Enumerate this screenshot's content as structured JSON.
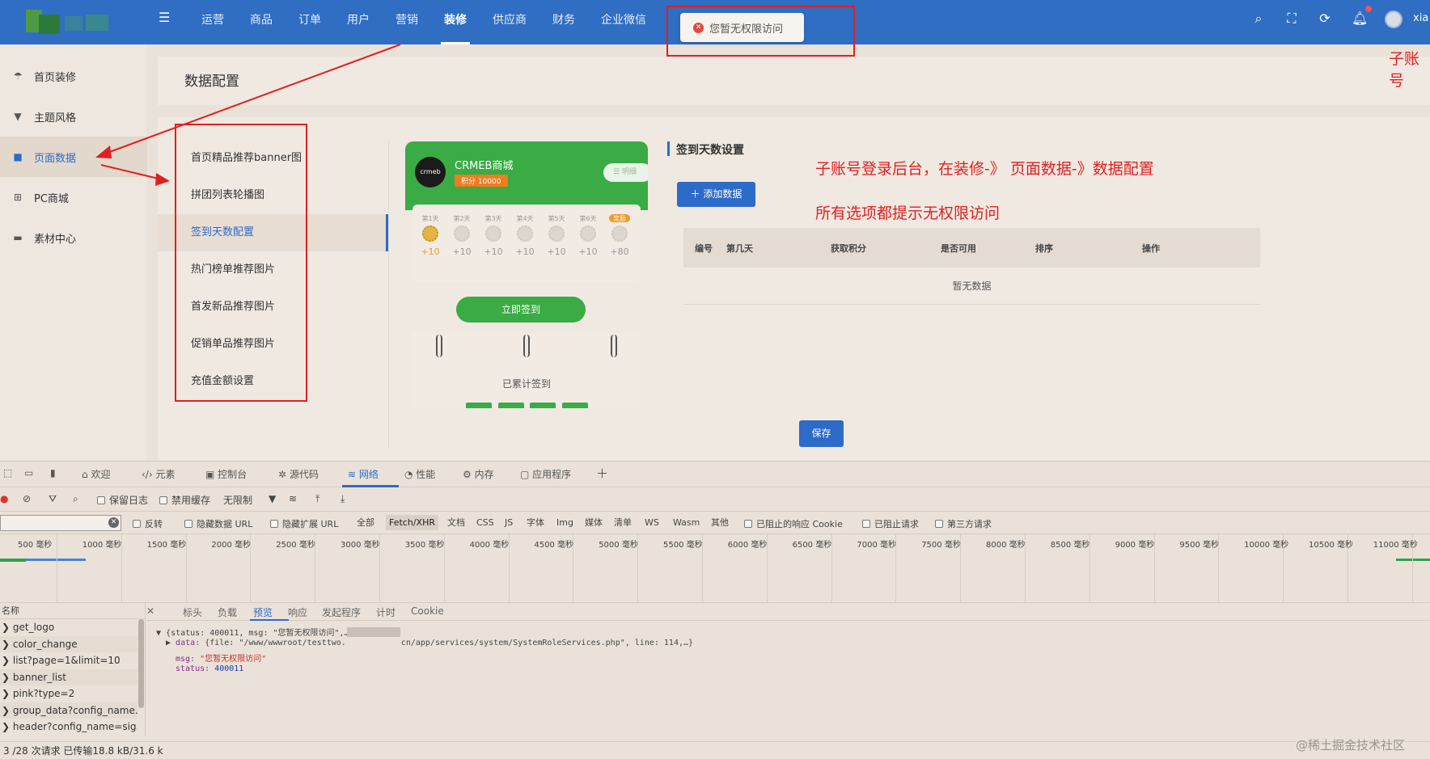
{
  "header": {
    "nav": [
      "运营",
      "商品",
      "订单",
      "用户",
      "营销",
      "装修",
      "供应商",
      "财务",
      "企业微信"
    ],
    "active_nav": "装修",
    "toast": "您暂无权限访问",
    "username": "xia",
    "annotation_corner": "子账号"
  },
  "sidebar": {
    "items": [
      "首页装修",
      "主题风格",
      "页面数据",
      "PC商城",
      "素材中心"
    ],
    "active": "页面数据"
  },
  "page": {
    "title": "数据配置",
    "submenu": [
      "首页精品推荐banner图",
      "拼团列表轮播图",
      "签到天数配置",
      "热门榜单推荐图片",
      "首发新品推荐图片",
      "促销单品推荐图片",
      "充值金额设置"
    ],
    "active_submenu": "签到天数配置",
    "save_label": "保存"
  },
  "preview": {
    "shop_name": "CRMEB商城",
    "points_badge": "积分 10000",
    "detail_label": "明细",
    "days": [
      {
        "label": "第1天",
        "points": "+10"
      },
      {
        "label": "第2天",
        "points": "+10"
      },
      {
        "label": "第3天",
        "points": "+10"
      },
      {
        "label": "第4天",
        "points": "+10"
      },
      {
        "label": "第5天",
        "points": "+10"
      },
      {
        "label": "第6天",
        "points": "+10"
      },
      {
        "label": "奖励",
        "points": "+80"
      }
    ],
    "sign_button": "立即签到",
    "cumulative_label": "已累计签到"
  },
  "config": {
    "section_title": "签到天数设置",
    "add_button": "添加数据",
    "table_headers": [
      "编号",
      "第几天",
      "获取积分",
      "是否可用",
      "排序",
      "操作"
    ],
    "empty_text": "暂无数据"
  },
  "annotations": {
    "line1": "子账号登录后台，在装修-》 页面数据-》数据配置",
    "line2": "所有选项都提示无权限访问"
  },
  "devtools": {
    "tabs": [
      "欢迎",
      "元素",
      "控制台",
      "源代码",
      "网络",
      "性能",
      "内存",
      "应用程序"
    ],
    "active_tab": "网络",
    "toolbar": {
      "preserve_log": "保留日志",
      "disable_cache": "禁用缓存",
      "throttle": "无限制"
    },
    "filter": {
      "invert": "反转",
      "hide_data_urls": "隐藏数据 URL",
      "hide_ext_urls": "隐藏扩展 URL",
      "types": [
        "全部",
        "Fetch/XHR",
        "文档",
        "CSS",
        "JS",
        "字体",
        "Img",
        "媒体",
        "清单",
        "WS",
        "Wasm",
        "其他"
      ],
      "active_type": "Fetch/XHR",
      "blocked_cookies": "已阻止的响应 Cookie",
      "blocked_requests": "已阻止请求",
      "third_party": "第三方请求"
    },
    "timeline_ticks": [
      "500 毫秒",
      "1000 毫秒",
      "1500 毫秒",
      "2000 毫秒",
      "2500 毫秒",
      "3000 毫秒",
      "3500 毫秒",
      "4000 毫秒",
      "4500 毫秒",
      "5000 毫秒",
      "5500 毫秒",
      "6000 毫秒",
      "6500 毫秒",
      "7000 毫秒",
      "7500 毫秒",
      "8000 毫秒",
      "8500 毫秒",
      "9000 毫秒",
      "9500 毫秒",
      "10000 毫秒",
      "10500 毫秒",
      "11000 毫秒"
    ],
    "name_header": "名称",
    "requests": [
      "get_logo",
      "color_change",
      "list?page=1&limit=10",
      "banner_list",
      "pink?type=2",
      "group_data?config_name...",
      "header?config_name=sig..."
    ],
    "preview_tabs": [
      "标头",
      "负载",
      "预览",
      "响应",
      "发起程序",
      "计时",
      "Cookie"
    ],
    "active_preview_tab": "预览",
    "response": {
      "summary": "{status: 400011, msg: \"您暂无权限访问\",…}",
      "data_key": "data:",
      "data_value_left": "{file: \"/www/wwwroot/testtwo.",
      "data_value_right": "cn/app/services/system/SystemRoleServices.php\", line: 114,…}",
      "msg_key": "msg:",
      "msg_value": "\"您暂无权限访问\"",
      "status_key": "status:",
      "status_value": "400011"
    },
    "status_bar": "3 /28 次请求   已传输18.8 kB/31.6 k"
  },
  "watermark": "@稀土掘金技术社区"
}
